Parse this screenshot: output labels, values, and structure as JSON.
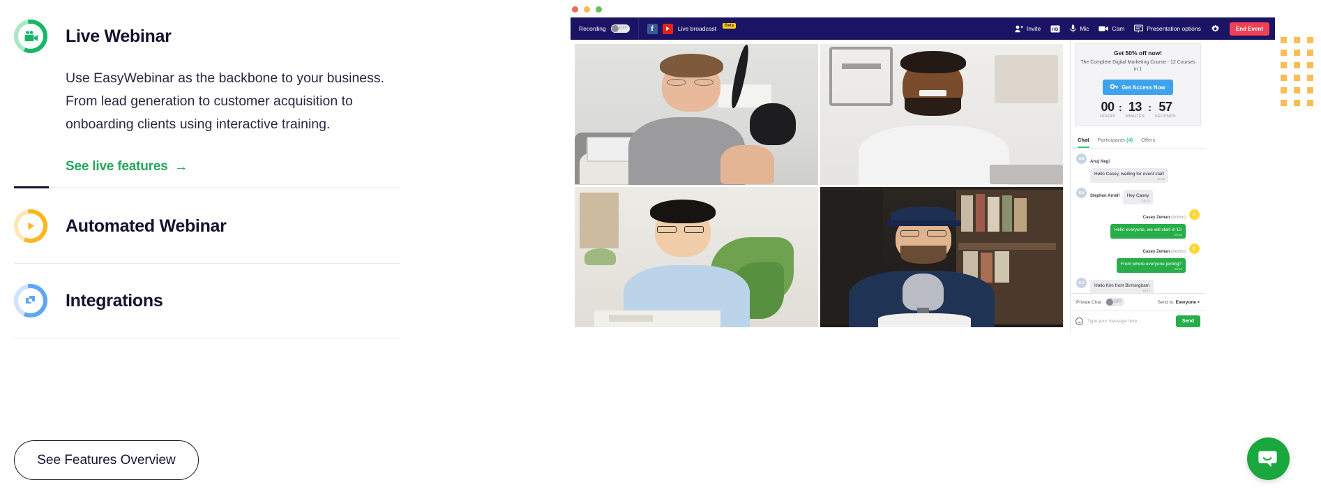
{
  "features": {
    "items": [
      {
        "id": "live-webinar",
        "title": "Live Webinar",
        "icon": "video-camera-icon",
        "ring_light": "#a9e8c6",
        "ring_dark": "#16b866",
        "expanded": true,
        "description": "Use EasyWebinar as the backbone to your business. From lead generation to customer acquisition to onboarding clients using interactive training.",
        "link_label": "See live features",
        "link_arrow": "→"
      },
      {
        "id": "automated-webinar",
        "title": "Automated Webinar",
        "icon": "play-circle-icon",
        "ring_light": "#fce7b6",
        "ring_dark": "#fbb621",
        "expanded": false
      },
      {
        "id": "integrations",
        "title": "Integrations",
        "icon": "integrations-squares-icon",
        "ring_light": "#cfe3fb",
        "ring_dark": "#5fa6f5",
        "expanded": false
      }
    ],
    "cta_label": "See Features Overview"
  },
  "app": {
    "window_dots": [
      "#ec6a5e",
      "#f4bd4f",
      "#61c554"
    ],
    "toolbar": {
      "recording_label": "Recording",
      "recording_state": "OFF",
      "broadcast_label": "Live broadcast",
      "broadcast_badge": "Beta",
      "facebook_icon": "facebook-icon",
      "youtube_icon": "youtube-icon",
      "invite_label": "Invite",
      "invite_icon": "add-person-icon",
      "hd_icon": "hd-badge-icon",
      "mic_label": "Mic",
      "mic_icon": "microphone-icon",
      "cam_label": "Cam",
      "cam_icon": "camera-icon",
      "presentation_label": "Presentation options",
      "presentation_icon": "presentation-screen-icon",
      "settings_icon": "gear-icon",
      "end_event_label": "End Event",
      "end_event_color": "#ef4056"
    },
    "video_grid": {
      "cells": [
        {
          "name": "participant-1",
          "description": "man with glasses in grey tee beside microphone"
        },
        {
          "name": "participant-2",
          "description": "man in white tee smiling with laptop"
        },
        {
          "name": "participant-3",
          "description": "man in light blue shirt at desk with plant"
        },
        {
          "name": "participant-4",
          "description": "man in navy cap and tee with studio microphone"
        }
      ]
    },
    "offer": {
      "headline": "Get 50% off now!",
      "subtext": "The Complete Digital Marketing Course - 12 Courses in 1",
      "button_label": "Get Access Now",
      "button_icon": "key-icon",
      "button_color": "#3ea3ec",
      "countdown": [
        {
          "value": "00",
          "label": "HOURS"
        },
        {
          "value": "13",
          "label": "MINUTES"
        },
        {
          "value": "57",
          "label": "SECONDS"
        }
      ],
      "separator": ":"
    },
    "chat": {
      "tabs": [
        {
          "label": "Chat",
          "active": true
        },
        {
          "label": "Participants",
          "count": "(4)",
          "active": false
        },
        {
          "label": "Offers",
          "active": false
        }
      ],
      "messages": [
        {
          "author": "Anuj Negi",
          "role": "",
          "initials": "AN",
          "text": "Hello Casey, waiting for event start",
          "time": "16:12",
          "outgoing": false
        },
        {
          "author": "Stephen Arnell",
          "role": "",
          "initials": "SA",
          "text": "Hey Casey",
          "time": "16:13",
          "outgoing": false
        },
        {
          "author": "Casey Zeman",
          "role": "(Admin)",
          "initials": "C",
          "text": "Hello everyone, we will start in 10",
          "time": "16:13",
          "outgoing": true
        },
        {
          "author": "Casey Zeman",
          "role": "(Admin)",
          "initials": "C",
          "text": "From where everyone joining?",
          "time": "16:14",
          "outgoing": true
        },
        {
          "author": "",
          "role": "",
          "initials": "KO",
          "text": "Hello Kim from Birmingham",
          "time": "16:17",
          "outgoing": false
        }
      ],
      "private_chat_label": "Private Chat",
      "private_chat_state": "OFF",
      "send_to_label": "Send to:",
      "send_to_value": "Everyone",
      "send_to_caret": "▾",
      "input_placeholder": "Type your message here...",
      "emoji_icon": "emoji-smile-icon",
      "send_label": "Send"
    }
  },
  "decoration": {
    "dot_grid_color": "#fbbd55",
    "dot_grid_rows": 6,
    "dot_grid_cols": 3
  },
  "intercom": {
    "icon": "chat-bubble-smile-icon",
    "color": "#1aa73e"
  }
}
